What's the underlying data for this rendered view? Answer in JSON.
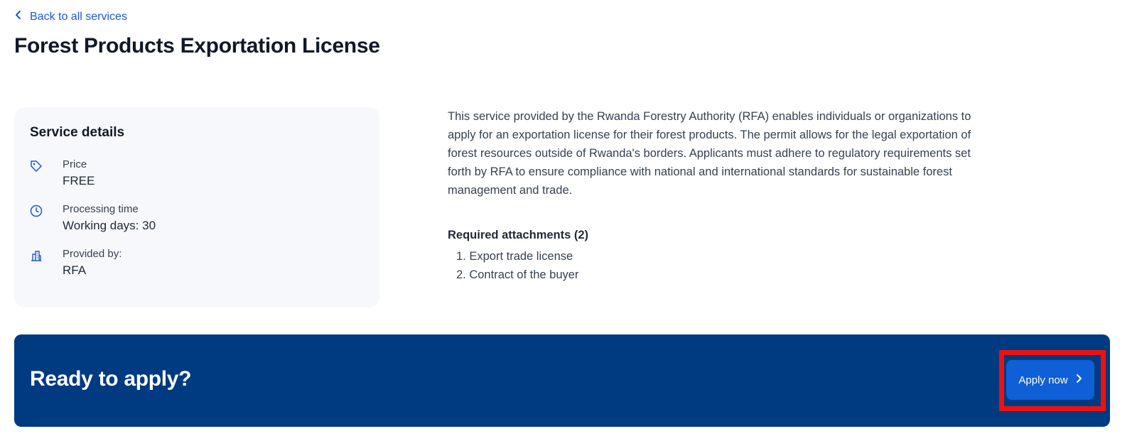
{
  "nav": {
    "back_label": "Back to all services"
  },
  "page": {
    "title": "Forest Products Exportation License"
  },
  "service_details": {
    "title": "Service details",
    "items": [
      {
        "icon": "price-tag-icon",
        "label": "Price",
        "value": "FREE"
      },
      {
        "icon": "clock-icon",
        "label": "Processing time",
        "value": "Working days: 30"
      },
      {
        "icon": "building-icon",
        "label": "Provided by:",
        "value": "RFA"
      }
    ]
  },
  "description": "This service provided by the Rwanda Forestry Authority (RFA) enables individuals or organizations to apply for an exportation license for their forest products. The permit allows for the legal exportation of forest resources outside of Rwanda's borders. Applicants must adhere to regulatory requirements set forth by RFA to ensure compliance with national and international standards for sustainable forest management and trade.",
  "attachments": {
    "title": "Required attachments (2)",
    "items": [
      "1. Export trade license",
      "2. Contract of the buyer"
    ]
  },
  "apply": {
    "heading": "Ready to apply?",
    "button_label": "Apply now"
  },
  "colors": {
    "accent_link": "#1a56db",
    "banner": "#003a80",
    "button": "#0f5fd6",
    "highlight": "#ee1111"
  }
}
